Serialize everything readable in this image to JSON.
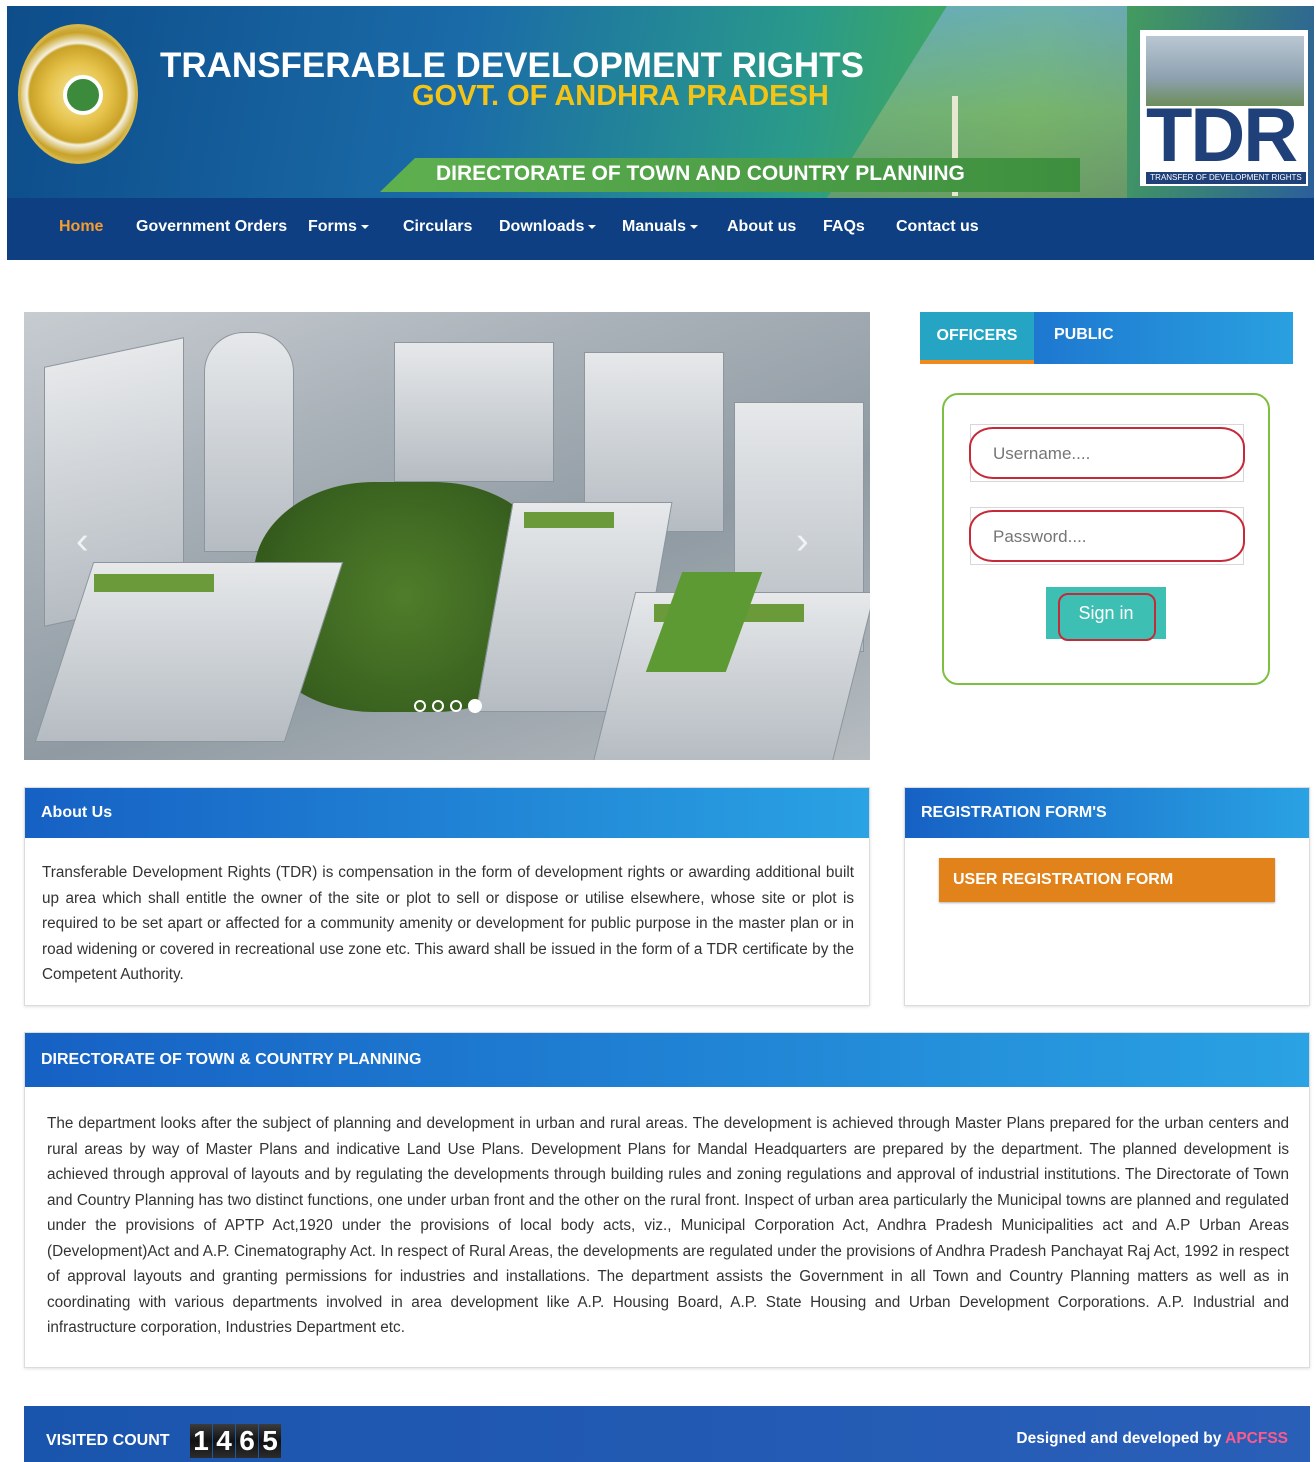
{
  "header": {
    "title": "TRANSFERABLE DEVELOPMENT RIGHTS",
    "subtitle": "GOVT. OF ANDHRA PRADESH",
    "directorate": "DIRECTORATE OF TOWN AND COUNTRY PLANNING",
    "logo_text": "TDR",
    "logo_subtext": "TRANSFER OF DEVELOPMENT RIGHTS"
  },
  "nav": {
    "items": [
      {
        "label": "Home",
        "active": true,
        "dropdown": false
      },
      {
        "label": "Government Orders",
        "active": false,
        "dropdown": false
      },
      {
        "label": "Forms",
        "active": false,
        "dropdown": true
      },
      {
        "label": "Circulars",
        "active": false,
        "dropdown": false
      },
      {
        "label": "Downloads",
        "active": false,
        "dropdown": true
      },
      {
        "label": "Manuals",
        "active": false,
        "dropdown": true
      },
      {
        "label": "About us",
        "active": false,
        "dropdown": false
      },
      {
        "label": "FAQs",
        "active": false,
        "dropdown": false
      },
      {
        "label": "Contact us",
        "active": false,
        "dropdown": false
      }
    ]
  },
  "carousel": {
    "slide_count": 4,
    "active_slide": 4,
    "prev_icon": "chevron-left-icon",
    "next_icon": "chevron-right-icon"
  },
  "login": {
    "tabs": [
      {
        "label": "OFFICERS",
        "active": true
      },
      {
        "label": "PUBLIC",
        "active": false
      }
    ],
    "username_placeholder": "Username....",
    "password_placeholder": "Password....",
    "signin_label": "Sign in"
  },
  "about": {
    "heading": "About Us",
    "body": "Transferable Development Rights (TDR) is compensation in the form of development rights or awarding additional built up area which shall entitle the owner of the site or plot to sell or dispose or utilise elsewhere, whose site or plot is required to be set apart or affected for a community amenity or development for public purpose in the master plan or in road widening or covered in recreational use zone etc. This award shall be issued in the form of a TDR certificate by the Competent Authority."
  },
  "registration": {
    "heading": "REGISTRATION FORM'S",
    "button_label": "USER REGISTRATION FORM"
  },
  "directorate_panel": {
    "heading": "DIRECTORATE OF TOWN & COUNTRY PLANNING",
    "body": "The department looks after the subject of planning and development in urban and rural areas. The development is achieved through Master Plans prepared for the urban centers and rural areas by way of Master Plans and indicative Land Use Plans. Development Plans for Mandal Headquarters are prepared by the department. The planned development is achieved through approval of layouts and by regulating the developments through building rules and zoning regulations and approval of industrial institutions. The Directorate of Town and Country Planning has two distinct functions, one under urban front and the other on the rural front. Inspect of urban area particularly the Municipal towns are planned and regulated under the provisions of APTP Act,1920 under the provisions of local body acts, viz., Municipal Corporation Act, Andhra Pradesh Municipalities act and A.P Urban Areas (Development)Act and A.P. Cinematography Act. In respect of Rural Areas, the developments are regulated under the provisions of Andhra Pradesh Panchayat Raj Act, 1992 in respect of approval layouts and granting permissions for industries and installations. The department assists the Government in all Town and Country Planning matters as well as in coordinating with various departments involved in area development like A.P. Housing Board, A.P. State Housing and Urban Development Corporations. A.P. Industrial and infrastructure corporation, Industries Department etc."
  },
  "footer": {
    "visited_label": "VISITED COUNT",
    "count_digits": [
      "1",
      "4",
      "6",
      "5"
    ],
    "credits_prefix": "Designed and developed by",
    "credits_brand": "APCFSS"
  },
  "colors": {
    "nav_bg": "#0e3f82",
    "nav_active": "#f39c32",
    "panel_head_start": "#1661c4",
    "panel_head_end": "#2aa2e3",
    "signin_bg": "#3dc0b3",
    "registration_btn": "#e2821a",
    "annotation_ring": "#c52a3a",
    "login_border": "#7fbf3f"
  }
}
